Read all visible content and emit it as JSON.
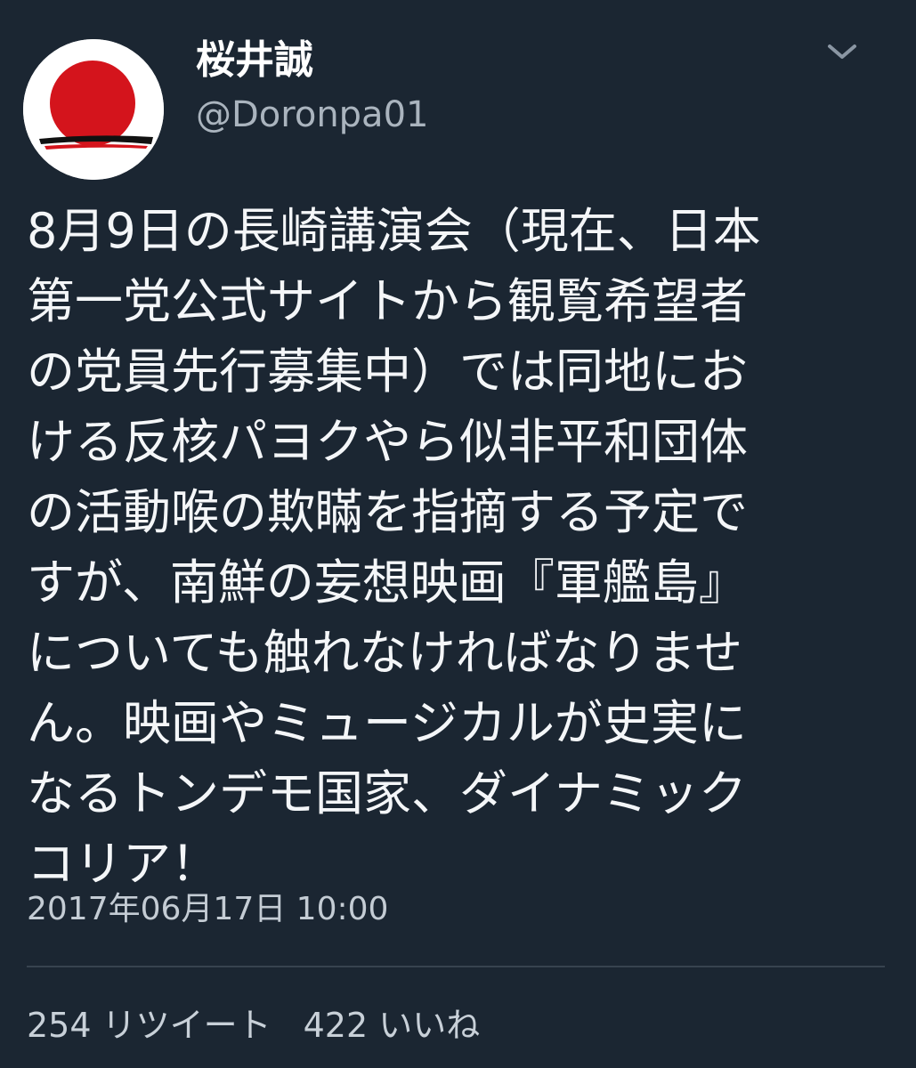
{
  "user": {
    "display_name": "桜井誠",
    "handle": "@Doronpa01",
    "avatar_icon": "rising-sun-flag-avatar"
  },
  "menu": {
    "icon": "chevron-down-icon"
  },
  "tweet": {
    "text_lines": [
      "8月9日の長崎講演会（現在、日本",
      "第一党公式サイトから観覧希望者",
      "の党員先行募集中）では同地にお",
      "ける反核パヨクやら似非平和団体",
      "の活動喉の欺瞞を指摘する予定で",
      "すが、南鮮の妄想映画『軍艦島』",
      "についても触れなければなりませ",
      "ん。映画やミュージカルが史実に",
      "なるトンデモ国家、ダイナミック",
      "コリア！"
    ],
    "timestamp": "2017年06月17日 10:00"
  },
  "stats": {
    "retweets": "254 リツイート",
    "likes": "422 いいね"
  },
  "colors": {
    "background": "#1b2632",
    "text": "#f4f6f8",
    "secondary": "#aab4be",
    "avatar_red": "#d4141c"
  }
}
